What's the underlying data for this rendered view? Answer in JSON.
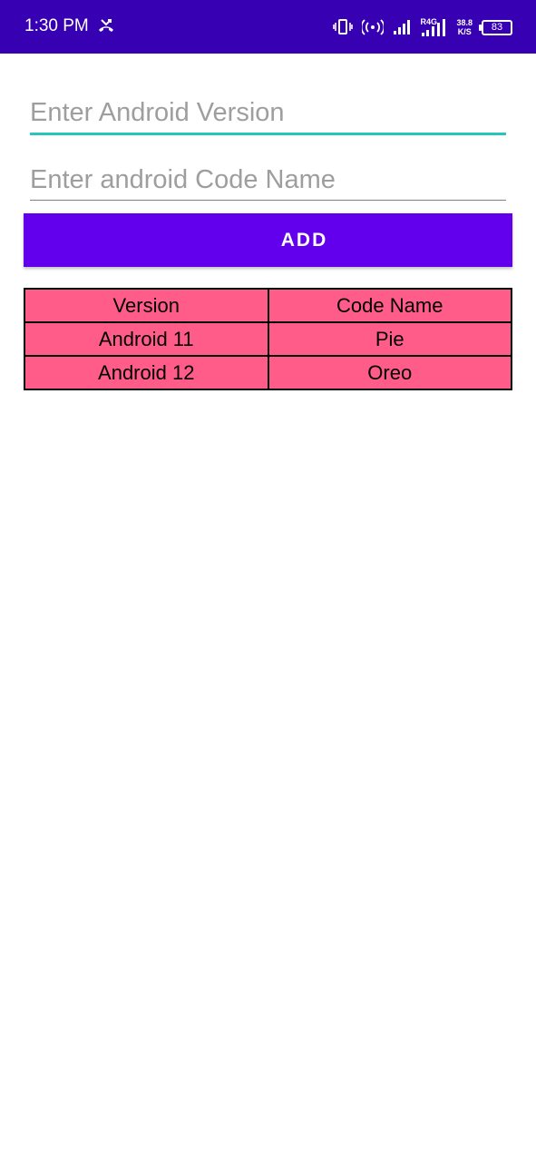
{
  "status_bar": {
    "time": "1:30 PM",
    "icons": [
      "missed-call-icon",
      "vibrate-icon",
      "hotspot-icon",
      "signal-icon",
      "signal-r4g-icon"
    ],
    "network_label": "R4G",
    "speed_value": "38.8",
    "speed_unit": "K/S",
    "battery": "83",
    "background_color": "#3700b3"
  },
  "form": {
    "version_placeholder": "Enter Android Version",
    "codename_placeholder": "Enter android Code Name",
    "focus_color": "#26c6b9"
  },
  "add_button": {
    "label": "ADD",
    "color": "#6200ee"
  },
  "table": {
    "header_color": "#ff5c8a",
    "columns": [
      "Version",
      "Code Name"
    ],
    "rows": [
      [
        "Android 11",
        "Pie"
      ],
      [
        "Android 12",
        "Oreo"
      ]
    ]
  }
}
